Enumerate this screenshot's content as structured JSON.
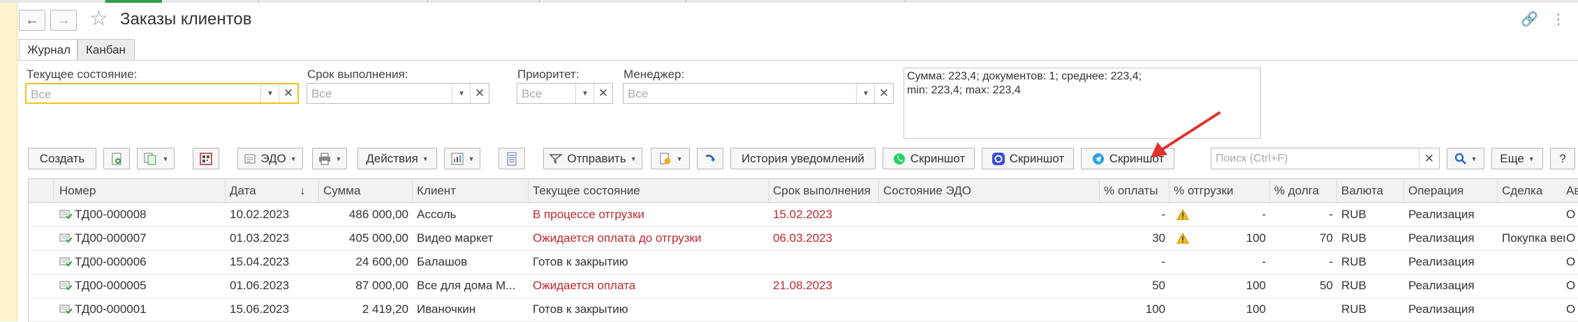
{
  "window": {
    "title": "Заказы клиентов",
    "tabs": [
      {
        "label": "Журнал",
        "active": true
      },
      {
        "label": "Канбан",
        "active": false
      }
    ]
  },
  "filters": {
    "state": {
      "label": "Текущее состояние:",
      "placeholder": "Все"
    },
    "deadline": {
      "label": "Срок выполнения:",
      "placeholder": "Все"
    },
    "priority": {
      "label": "Приоритет:",
      "placeholder": "Все"
    },
    "manager": {
      "label": "Менеджер:",
      "placeholder": "Все"
    }
  },
  "summary": {
    "line1": "Сумма: 223,4; документов: 1; среднее: 223,4;",
    "line2": "min: 223,4; max: 223,4"
  },
  "toolbar": {
    "create": "Создать",
    "edo": "ЭДО",
    "actions": "Действия",
    "send": "Отправить",
    "history": "История уведомлений",
    "screenshot_whatsapp": "Скриншот",
    "screenshot_max": "Скриншот",
    "screenshot_telegram": "Скриншот",
    "search_placeholder": "Поиск (Ctrl+F)",
    "more": "Еще",
    "help": "?"
  },
  "table": {
    "columns": {
      "number": "Номер",
      "date": "Дата",
      "sum": "Сумма",
      "client": "Клиент",
      "state": "Текущее состояние",
      "deadline": "Срок выполнения",
      "edo_state": "Состояние ЭДО",
      "pay_pct": "% оплаты",
      "ship_pct": "% отгрузки",
      "debt_pct": "% долга",
      "currency": "Валюта",
      "operation": "Операция",
      "deal": "Сделка",
      "extra": "Ав"
    },
    "sort_arrow": "↓",
    "rows": [
      {
        "number": "ТД00-000008",
        "date": "10.02.2023",
        "sum": "486 000,00",
        "client": "Ассоль",
        "state": "В процессе отгрузки",
        "state_red": true,
        "deadline": "15.02.2023",
        "pay": "-",
        "warn": true,
        "ship": "-",
        "debt": "-",
        "currency": "RUB",
        "operation": "Реализация",
        "deal": "",
        "extra": "О"
      },
      {
        "number": "ТД00-000007",
        "date": "01.03.2023",
        "sum": "405 000,00",
        "client": "Видео маркет",
        "state": "Ожидается оплата до отгрузки",
        "state_red": true,
        "deadline": "06.03.2023",
        "pay": "30",
        "warn": true,
        "ship": "100",
        "debt": "70",
        "currency": "RUB",
        "operation": "Реализация",
        "deal": "Покупка вен...",
        "extra": "О"
      },
      {
        "number": "ТД00-000006",
        "date": "15.04.2023",
        "sum": "24 600,00",
        "client": "Балашов",
        "state": "Готов к закрытию",
        "state_red": false,
        "deadline": "",
        "pay": "-",
        "warn": false,
        "ship": "-",
        "debt": "-",
        "currency": "RUB",
        "operation": "Реализация",
        "deal": "",
        "extra": "О"
      },
      {
        "number": "ТД00-000005",
        "date": "01.06.2023",
        "sum": "87 000,00",
        "client": "Все для дома М...",
        "state": "Ожидается оплата",
        "state_red": true,
        "deadline": "21.08.2023",
        "pay": "50",
        "warn": false,
        "ship": "100",
        "debt": "50",
        "currency": "RUB",
        "operation": "Реализация",
        "deal": "",
        "extra": "О"
      },
      {
        "number": "ТД00-000001",
        "date": "15.06.2023",
        "sum": "2 419,20",
        "client": "Иваночкин",
        "state": "Готов к закрытию",
        "state_red": false,
        "deadline": "",
        "pay": "100",
        "warn": false,
        "ship": "100",
        "debt": "",
        "currency": "RUB",
        "operation": "Реализация",
        "deal": "",
        "extra": "О"
      }
    ]
  },
  "colors": {
    "accent_yellow": "#f2c01b",
    "status_red": "#c0282d",
    "arrow_red": "#e0322c",
    "whatsapp": "#25d366",
    "telegram": "#2aa3e0",
    "max": "#3b4bd8"
  },
  "icons": [
    "back-arrow-icon",
    "forward-arrow-icon",
    "favorite-star-icon",
    "link-icon",
    "kebab-menu-icon",
    "document-icon",
    "warning-icon",
    "search-icon",
    "whatsapp-icon",
    "telegram-icon",
    "max-icon"
  ]
}
